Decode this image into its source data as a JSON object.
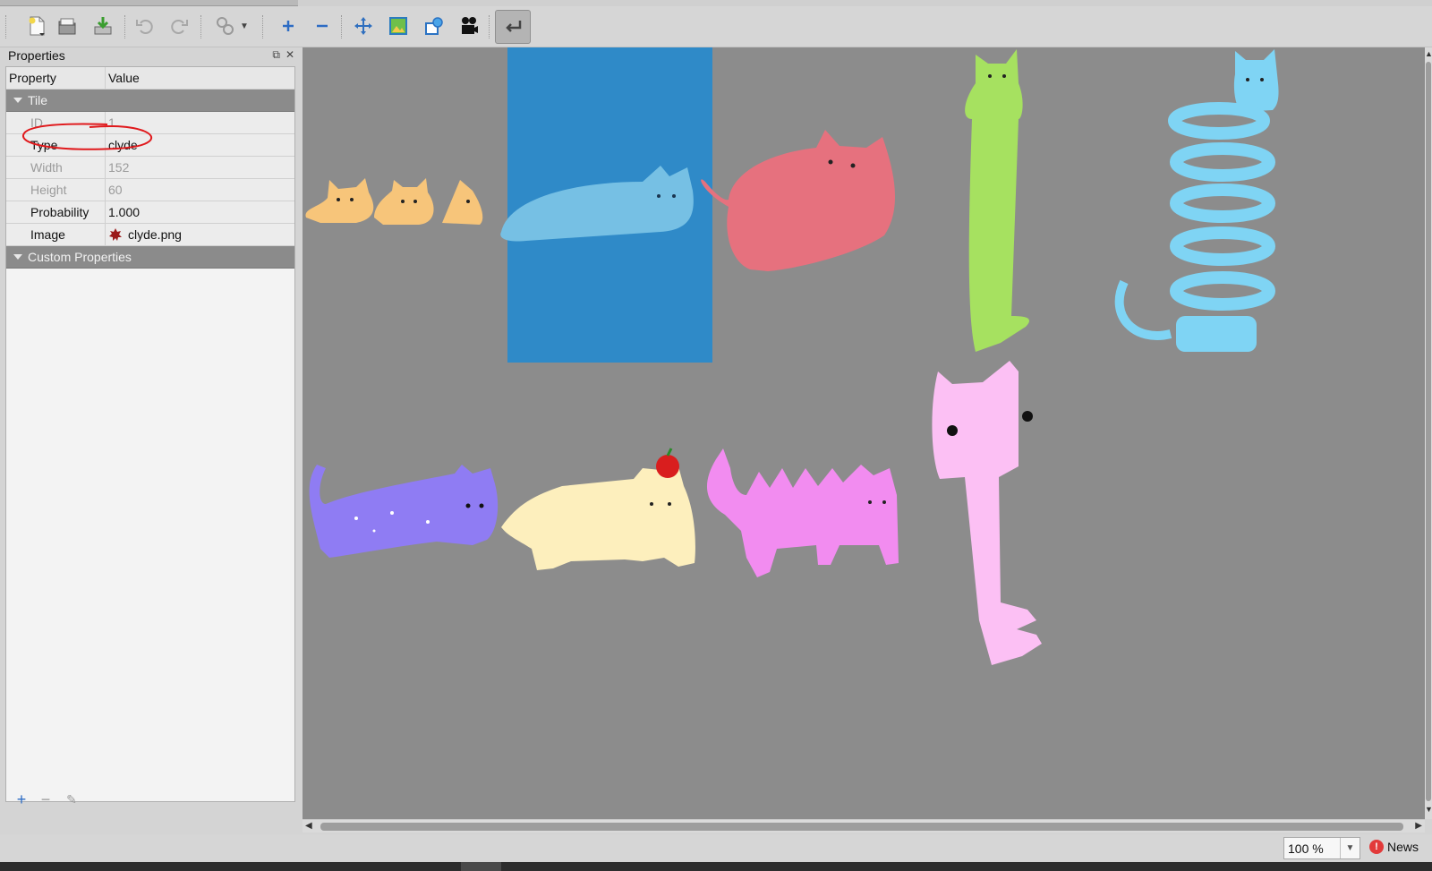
{
  "properties_panel": {
    "title": "Properties",
    "header": {
      "property": "Property",
      "value": "Value"
    },
    "tile_group": "Tile",
    "rows": [
      {
        "name": "ID",
        "value": "1",
        "dim": true
      },
      {
        "name": "Type",
        "value": "clyde",
        "dim": false
      },
      {
        "name": "Width",
        "value": "152",
        "dim": true
      },
      {
        "name": "Height",
        "value": "60",
        "dim": true
      },
      {
        "name": "Probability",
        "value": "1.000",
        "dim": false
      },
      {
        "name": "Image",
        "value": "clyde.png",
        "dim": false
      }
    ],
    "custom_group": "Custom Properties"
  },
  "statusbar": {
    "zoom": "100 %",
    "news": "News"
  },
  "colors": {
    "selection": "#2f8ac8",
    "canvas": "#8c8c8c",
    "annotation": "#e0191c"
  },
  "toolbar_icons": [
    "new-file-icon",
    "open-file-icon",
    "save-icon",
    "undo-icon",
    "redo-icon",
    "tool-settings-icon",
    "add-icon",
    "remove-icon",
    "move-icon",
    "image-edit-icon",
    "shapes-icon",
    "animation-camera-icon",
    "return-icon"
  ]
}
